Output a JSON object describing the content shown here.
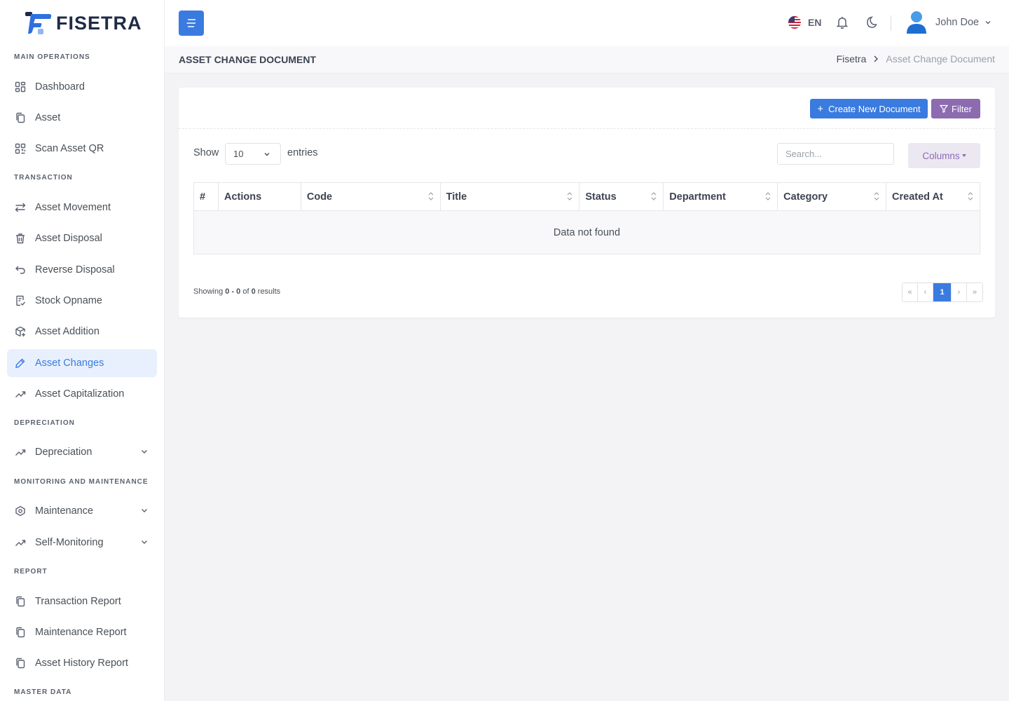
{
  "brand": {
    "name": "FISETRA"
  },
  "sidebar": {
    "sections": [
      {
        "title": "MAIN OPERATIONS"
      },
      {
        "title": "TRANSACTION"
      },
      {
        "title": "DEPRECIATION"
      },
      {
        "title": "MONITORING AND MAINTENANCE"
      },
      {
        "title": "REPORT"
      },
      {
        "title": "MASTER DATA"
      }
    ],
    "items": [
      {
        "label": "Dashboard",
        "icon": "grid-icon"
      },
      {
        "label": "Asset",
        "icon": "copy-icon"
      },
      {
        "label": "Scan Asset QR",
        "icon": "qr-icon"
      },
      {
        "label": "Asset Movement",
        "icon": "arrows-icon"
      },
      {
        "label": "Asset Disposal",
        "icon": "trash-icon"
      },
      {
        "label": "Reverse Disposal",
        "icon": "undo-icon"
      },
      {
        "label": "Stock Opname",
        "icon": "clipboard-check-icon"
      },
      {
        "label": "Asset Addition",
        "icon": "box-plus-icon"
      },
      {
        "label": "Asset Changes",
        "icon": "pencil-icon",
        "active": true
      },
      {
        "label": "Asset Capitalization",
        "icon": "trend-icon"
      },
      {
        "label": "Depreciation",
        "icon": "trend-icon"
      },
      {
        "label": "Maintenance",
        "icon": "hexagon-icon"
      },
      {
        "label": "Self-Monitoring",
        "icon": "trend-icon"
      },
      {
        "label": "Transaction Report",
        "icon": "copy-icon"
      },
      {
        "label": "Maintenance Report",
        "icon": "copy-icon"
      },
      {
        "label": "Asset History Report",
        "icon": "copy-icon"
      }
    ]
  },
  "header": {
    "language": "EN",
    "user_name": "John Doe"
  },
  "page": {
    "title": "ASSET CHANGE DOCUMENT",
    "breadcrumb_root": "Fisetra",
    "breadcrumb_current": "Asset Change Document"
  },
  "toolbar": {
    "create_label": "Create New Document",
    "filter_label": "Filter",
    "columns_label": "Columns"
  },
  "table": {
    "show_label": "Show",
    "entries_value": "10",
    "entries_label": "entries",
    "search_placeholder": "Search...",
    "columns": [
      "#",
      "Actions",
      "Code",
      "Title",
      "Status",
      "Department",
      "Category",
      "Created At"
    ],
    "empty_message": "Data not found"
  },
  "footer": {
    "showing_prefix": "Showing",
    "range": "0 - 0",
    "of": "of",
    "total": "0",
    "results": "results"
  },
  "pagination": {
    "first": "«",
    "prev": "‹",
    "current": "1",
    "next": "›",
    "last": "»"
  },
  "colors": {
    "primary": "#3a7be0",
    "filter": "#8c6bb1",
    "active_bg": "#e8f0fd",
    "page_bg": "#f3f3f6"
  }
}
